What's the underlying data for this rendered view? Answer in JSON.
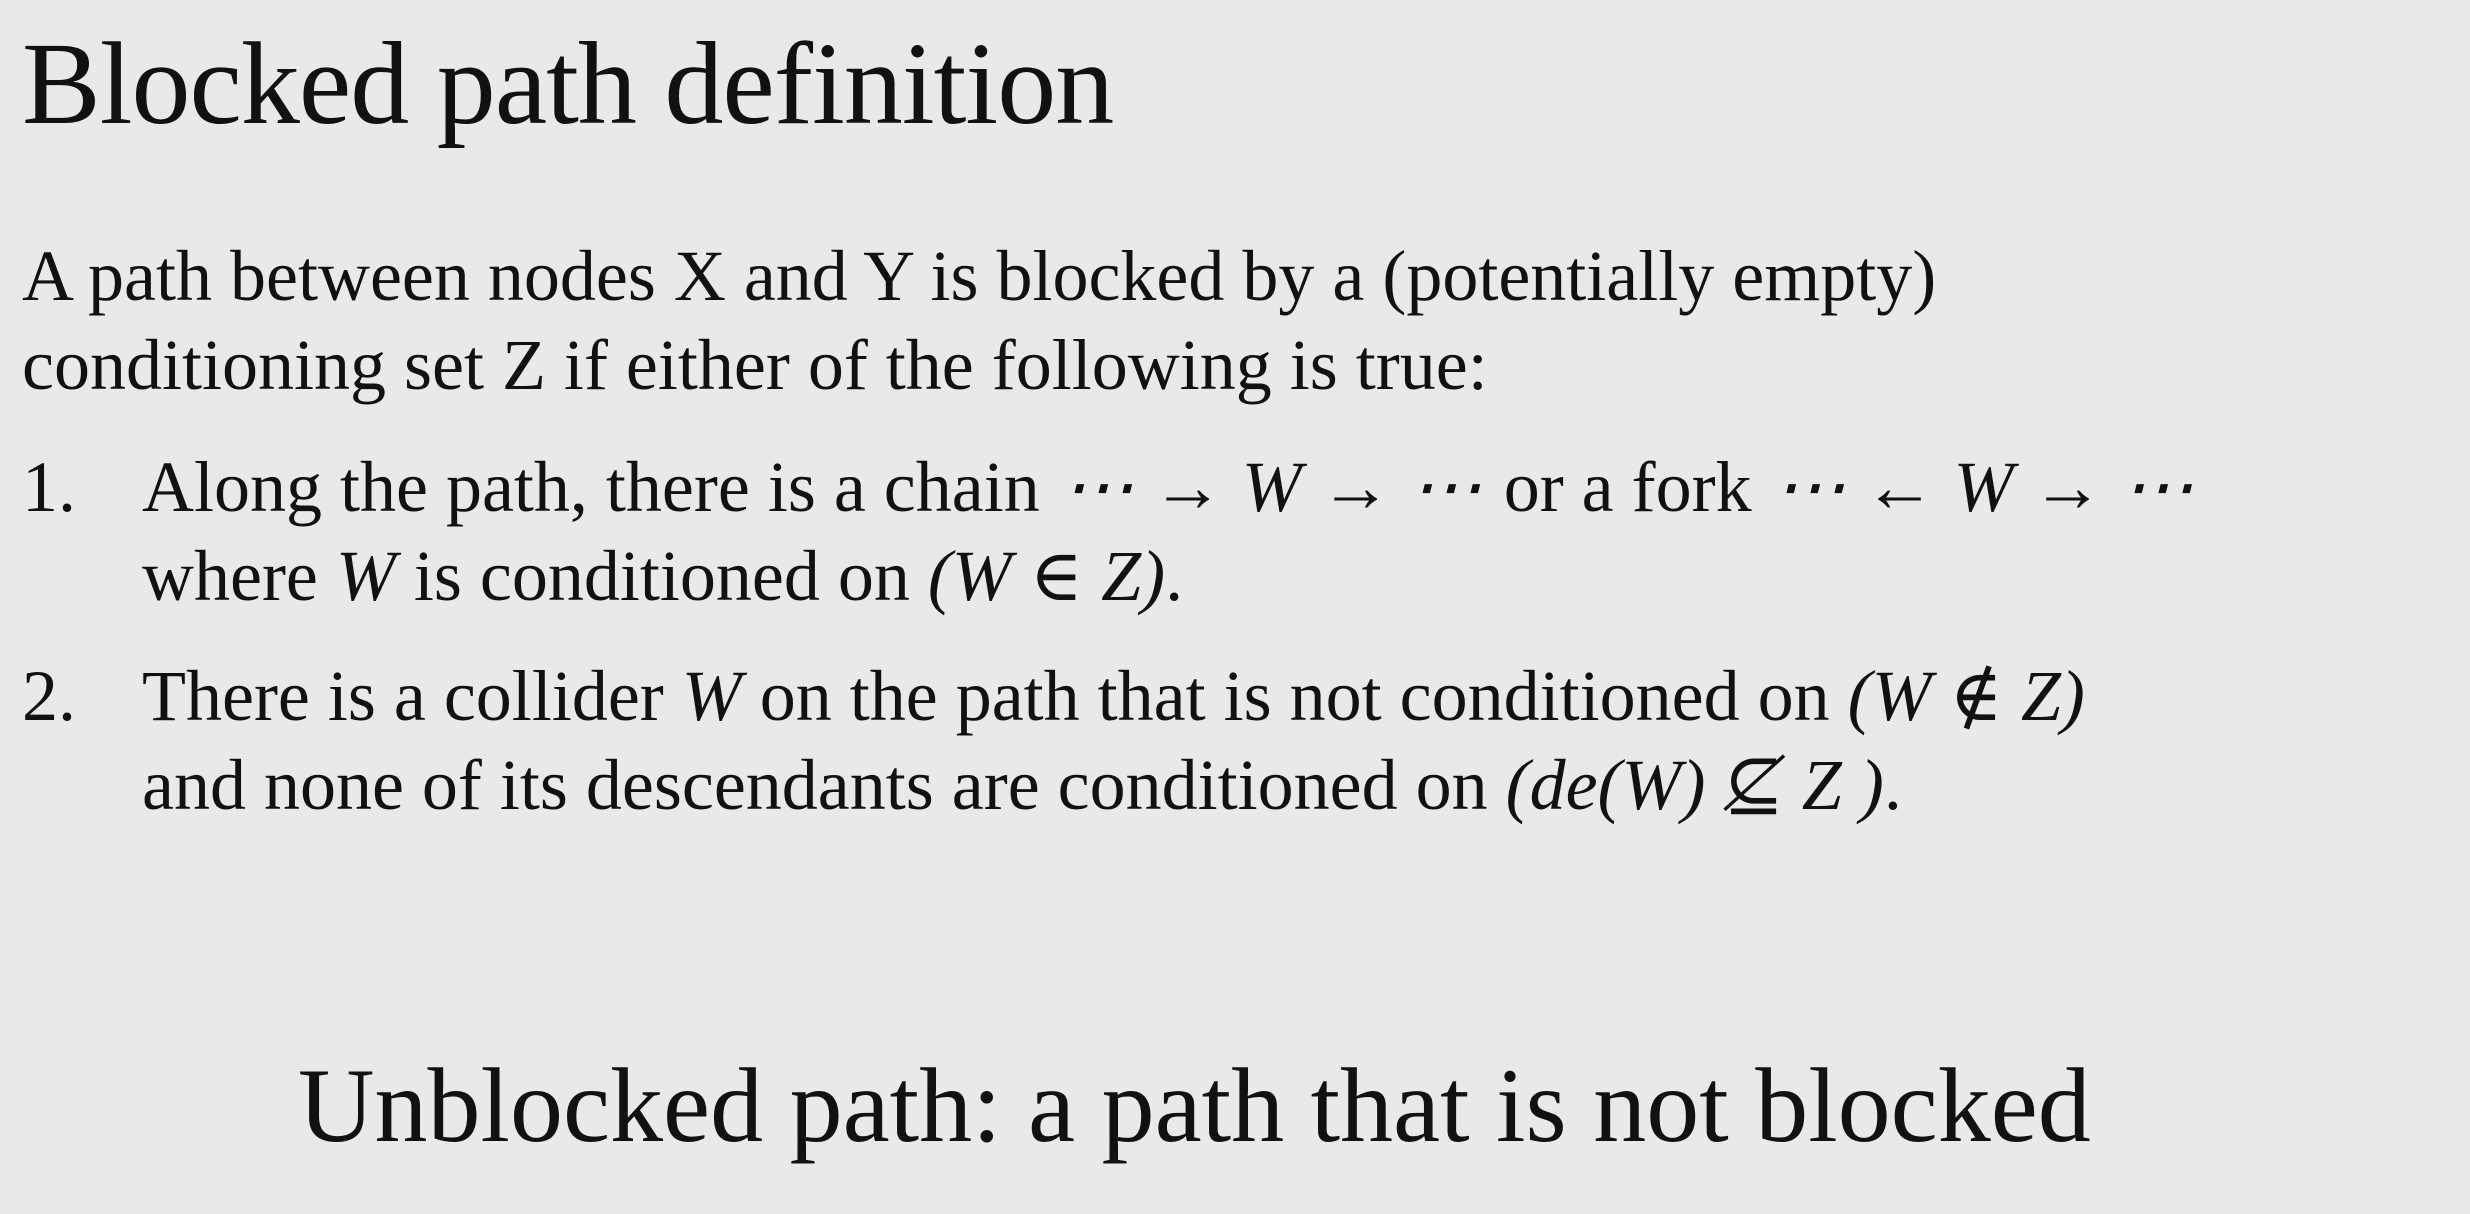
{
  "slide": {
    "title": "Blocked path definition",
    "intro": {
      "line1": "A path between nodes X and Y is blocked by a (potentially empty)",
      "line2": "conditioning set Z if either of the following is true:"
    },
    "items": [
      {
        "number": "1.",
        "line1_text_a": "Along the path, there is a chain",
        "chain_expr": "⋯ → W → ⋯",
        "line1_text_b": "or a fork",
        "fork_expr": "⋯ ← W → ⋯",
        "line2_text_a": "where",
        "line2_var": "W",
        "line2_text_b": "is conditioned on",
        "line2_expr": "(W ∈ Z)",
        "line2_end": "."
      },
      {
        "number": "2.",
        "line1_text_a": "There is a collider",
        "line1_var": "W",
        "line1_text_b": "on the path that is not conditioned on",
        "line1_expr": "(W ∉ Z)",
        "line2_text_a": "and none of its descendants are conditioned on",
        "line2_expr": "(de(W) ⊈ Z )",
        "line2_end": "."
      }
    ],
    "footer": "Unblocked path: a path that is not blocked"
  }
}
